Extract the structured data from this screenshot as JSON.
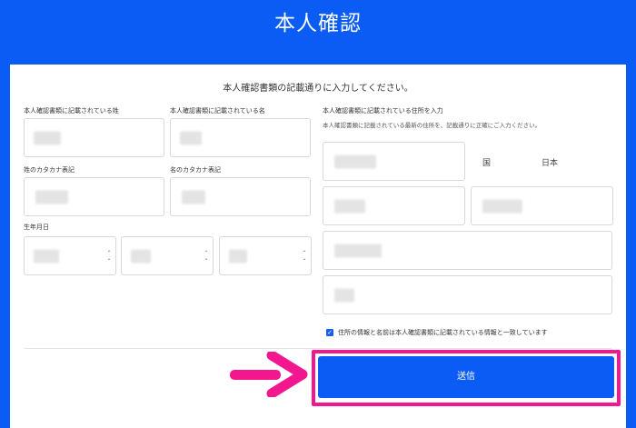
{
  "header": {
    "title": "本人確認"
  },
  "form": {
    "instruction": "本人確認書類の記載通りに入力してください。",
    "last_name_label": "本人確認書類に記載されている姓",
    "first_name_label": "本人確認書類に記載されている名",
    "last_name_kana_label": "姓のカタカナ表記",
    "first_name_kana_label": "名のカタカナ表記",
    "birthdate_label": "生年月日",
    "address_label": "本人確認書類に記載されている住所を入力",
    "address_hint": "本人確認書類に記載されている最新の住所を、記載通りに正確にご入力ください。",
    "country_label": "国",
    "country_value": "日本",
    "confirm_checkbox_label": "住所の情報と名前は本人確認書類に記載されている情報と一致しています",
    "confirm_checked": true,
    "submit_label": "送信"
  },
  "colors": {
    "background": "#0a5cf5",
    "button": "#0a5cf5",
    "highlight": "#f2178f"
  },
  "icons": {
    "spinner": "up-down-chevron-icon",
    "checkbox": "checkmark-icon",
    "annotation": "arrow-right-icon"
  }
}
